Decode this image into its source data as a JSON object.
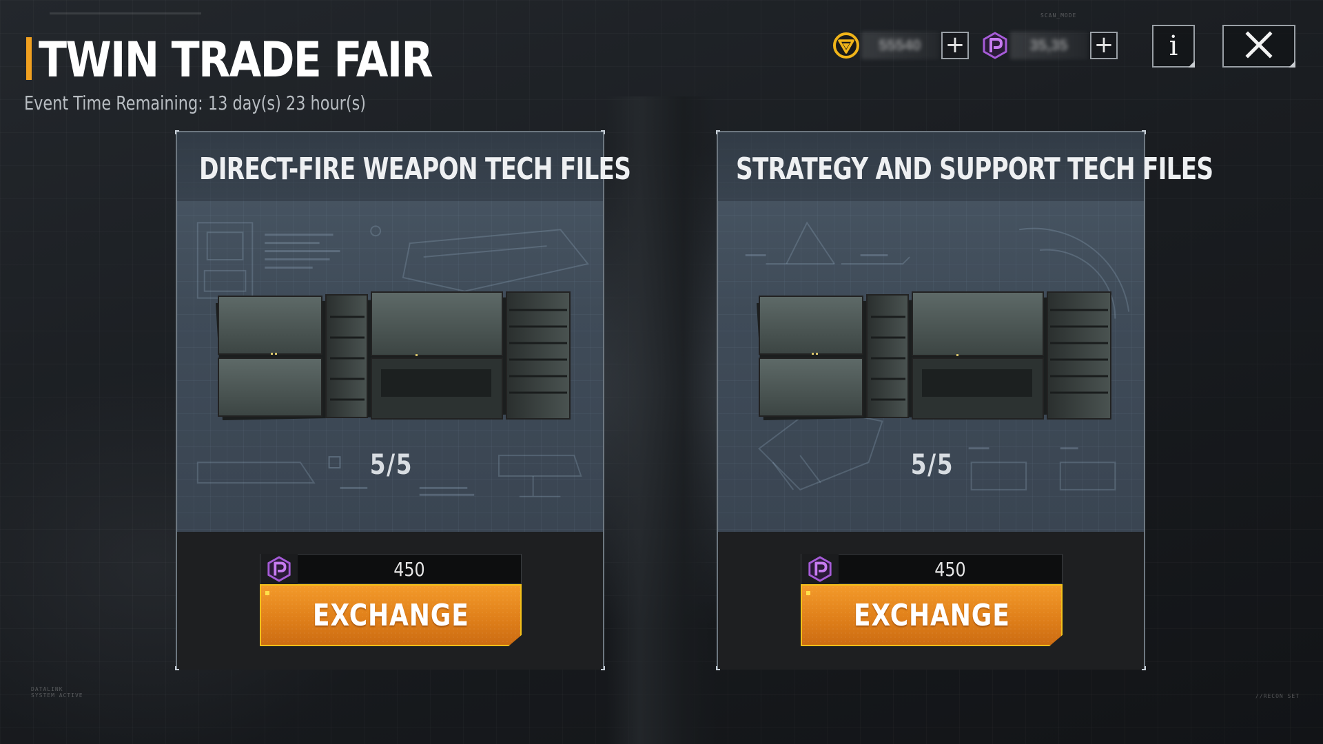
{
  "header": {
    "title": "TWIN TRADE FAIR",
    "event_time": "Event Time Remaining: 13 day(s) 23 hour(s)"
  },
  "currencies": [
    {
      "icon": "gold-triangle-coin-icon",
      "value": "55540",
      "color": "#f0b419"
    },
    {
      "icon": "purple-p-token-icon",
      "value": "35,35",
      "color": "#a65bd8"
    }
  ],
  "buttons": {
    "plus": "+",
    "info": "i",
    "close": "✕"
  },
  "cards": [
    {
      "title": "DIRECT-FIRE WEAPON TECH FILES",
      "count": "5/5",
      "price": "450",
      "price_icon": "purple-p-token-icon",
      "exchange_label": "EXCHANGE"
    },
    {
      "title": "STRATEGY AND SUPPORT TECH FILES",
      "count": "5/5",
      "price": "450",
      "price_icon": "purple-p-token-icon",
      "exchange_label": "EXCHANGE"
    }
  ],
  "colors": {
    "accent_orange": "#f0a020",
    "button_orange": "#e0801a",
    "button_border": "#f3c01a",
    "token_purple": "#a65bd8",
    "coin_gold": "#f0b419"
  }
}
